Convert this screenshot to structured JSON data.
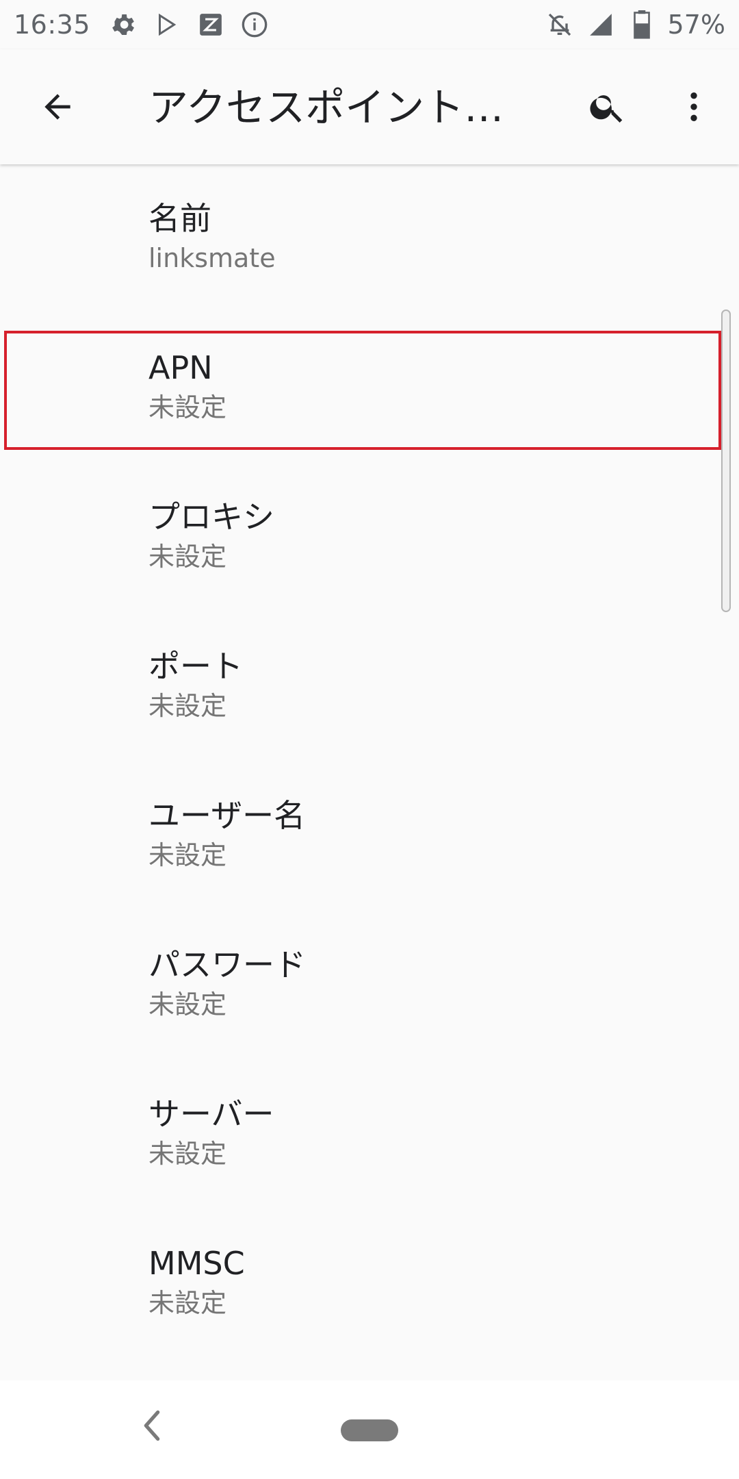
{
  "status_bar": {
    "time": "16:35",
    "battery_percent": "57%",
    "icons_left": [
      "gear-icon",
      "play-store-icon",
      "app-store-icon",
      "info-icon"
    ],
    "icons_right": [
      "notifications-off-icon",
      "signal-icon",
      "battery-icon"
    ]
  },
  "app_bar": {
    "title": "アクセスポイント…",
    "icons": [
      "back-arrow-icon",
      "search-icon",
      "more-vert-icon"
    ]
  },
  "preferences": [
    {
      "title": "名前",
      "summary": "linksmate"
    },
    {
      "title": "APN",
      "summary": "未設定"
    },
    {
      "title": "プロキシ",
      "summary": "未設定"
    },
    {
      "title": "ポート",
      "summary": "未設定"
    },
    {
      "title": "ユーザー名",
      "summary": "未設定"
    },
    {
      "title": "パスワード",
      "summary": "未設定"
    },
    {
      "title": "サーバー",
      "summary": "未設定"
    },
    {
      "title": "MMSC",
      "summary": "未設定"
    }
  ],
  "highlighted_index": 1,
  "colors": {
    "background": "#fafafa",
    "highlight_border": "#d6202c",
    "title_text": "#202124",
    "summary_text": "#757575"
  },
  "nav_bar": {
    "icons": [
      "nav-back-icon",
      "home-pill-icon"
    ]
  }
}
